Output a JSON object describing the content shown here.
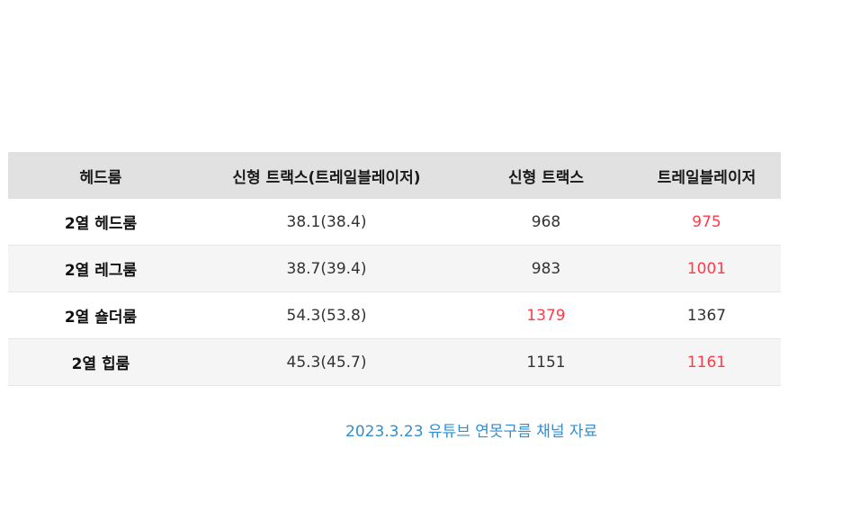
{
  "table": {
    "headers": [
      "헤드룸",
      "신형 트랙스(트레일블레이저)",
      "신형 트랙스",
      "트레일블레이저"
    ],
    "rows": [
      {
        "label": "2열 헤드룸",
        "combined": "38.1(38.4)",
        "trax": "968",
        "trailblazer": "975",
        "highlight": "trailblazer"
      },
      {
        "label": "2열 레그룸",
        "combined": "38.7(39.4)",
        "trax": "983",
        "trailblazer": "1001",
        "highlight": "trailblazer"
      },
      {
        "label": "2열 숄더룸",
        "combined": "54.3(53.8)",
        "trax": "1379",
        "trailblazer": "1367",
        "highlight": "trax"
      },
      {
        "label": "2열 힙룸",
        "combined": "45.3(45.7)",
        "trax": "1151",
        "trailblazer": "1161",
        "highlight": "trailblazer"
      }
    ]
  },
  "source_note": "2023.3.23 유튜브 연못구름 채널 자료",
  "colors": {
    "highlight": "#ff3b48",
    "header_bg": "#e1e1e1",
    "link": "#2f8fd0"
  }
}
